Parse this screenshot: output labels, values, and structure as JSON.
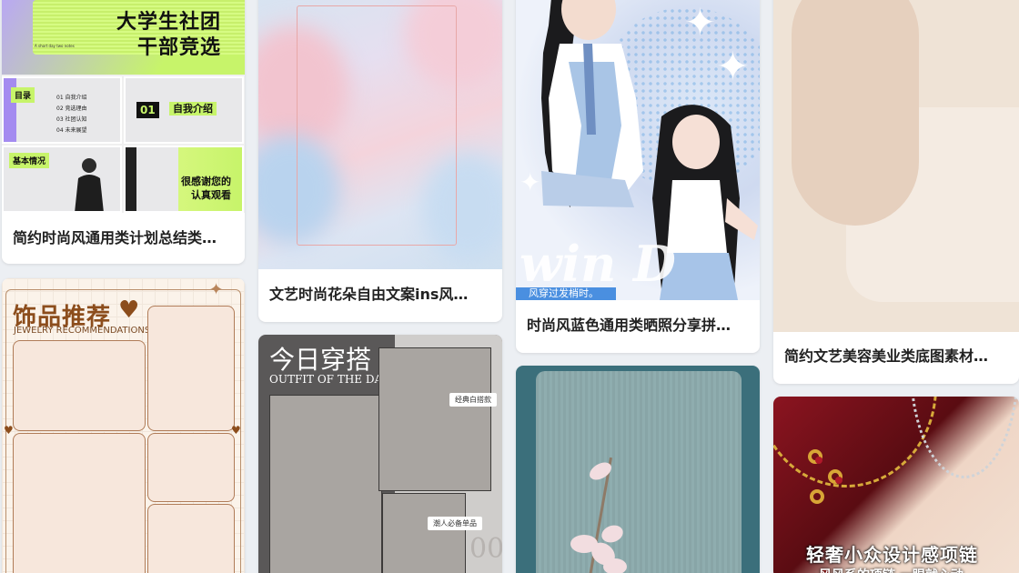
{
  "cards": [
    {
      "title": "简约时尚风通用类计划总结类…",
      "thumb_text": {
        "hero_line1": "大学生社团",
        "hero_line2": "干部竞选",
        "hero_small": "A short day two notes",
        "toc_tag": "目录",
        "toc_items": [
          "01 自我介绍",
          "02 竞选理由",
          "03 社团认知",
          "04 未来展望"
        ],
        "part_tag": "01",
        "part_title": "自我介绍",
        "basic_tag": "基本情况",
        "thanks_line1": "很感谢您的",
        "thanks_line2": "认真观看"
      }
    },
    {
      "title": "文艺时尚花朵自由文案ins风…"
    },
    {
      "title": "时尚风蓝色通用类晒照分享拼…",
      "thumb_text": {
        "script": "win D",
        "caption": "风穿过发梢时。"
      }
    },
    {
      "title": "简约文艺美容美业类底图素材…"
    },
    {
      "thumb_text": {
        "heading": "饰品推荐",
        "subheading": "JEWELRY RECOMMENDATIONS"
      }
    },
    {
      "thumb_text": {
        "heading": "今日穿搭",
        "subheading": "OUTFIT OF THE DAY",
        "tag1": "经典白搭款",
        "tag2": "潮人必备单品"
      }
    },
    {},
    {
      "thumb_text": {
        "heading": "轻奢小众设计感项链",
        "subheading": "风风系的项链 一眼就心动"
      }
    }
  ],
  "colors": {
    "background": "#eceff3",
    "card": "#ffffff",
    "lime": "#c7f46a",
    "violet": "#b9a6f7",
    "brown": "#8c4d1c",
    "teal": "#3b6f7b"
  }
}
